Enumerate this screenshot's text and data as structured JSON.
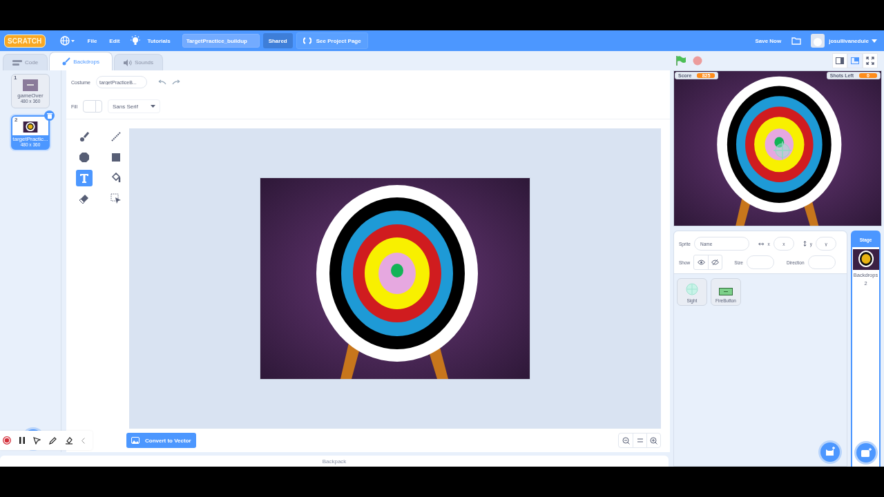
{
  "menu_bar": {
    "logo": "SCRATCH",
    "items": [
      {
        "kind": "globe"
      },
      {
        "kind": "text",
        "label": "File"
      },
      {
        "kind": "text",
        "label": "Edit"
      },
      {
        "kind": "tutorials",
        "label": "Tutorials"
      }
    ],
    "project_title": "TargetPractice_buildup",
    "shared": "Shared",
    "see_project": "See Project Page",
    "save_now": "Save Now",
    "user": "josullivaneduie"
  },
  "tabs": [
    {
      "kind": "code",
      "label": "Code",
      "selected": false
    },
    {
      "kind": "backdrops",
      "label": "Backdrops",
      "selected": true
    },
    {
      "kind": "sounds",
      "label": "Sounds",
      "selected": false
    }
  ],
  "backdrops": [
    {
      "number": "1",
      "name": "gameOver",
      "size": "480 x 360",
      "kind": "blank",
      "selected": false
    },
    {
      "number": "2",
      "name": "targetPractic...",
      "size": "480 x 360",
      "kind": "target",
      "selected": true
    }
  ],
  "paint_editor": {
    "costume_label": "Costume",
    "costume_name": "targetPracticeB...",
    "fill_label": "Fill",
    "font": "Sans Serif",
    "tools": [
      {
        "kind": "brush",
        "selected": false
      },
      {
        "kind": "line",
        "selected": false
      },
      {
        "kind": "circle",
        "selected": false
      },
      {
        "kind": "rectangle",
        "selected": false
      },
      {
        "kind": "text",
        "selected": true
      },
      {
        "kind": "fill",
        "selected": false
      },
      {
        "kind": "eraser",
        "selected": false
      },
      {
        "kind": "select",
        "selected": false
      }
    ],
    "convert_button": "Convert to Vector"
  },
  "stage": {
    "monitors": [
      {
        "label": "Score",
        "value": "825"
      },
      {
        "label": "Shots Left",
        "value": "0"
      }
    ]
  },
  "sprite_info": {
    "sprite_label": "Sprite",
    "name_placeholder": "Name",
    "x_label": "x",
    "x_placeholder": "x",
    "y_label": "y",
    "y_placeholder": "y",
    "show_label": "Show",
    "size_label": "Size",
    "direction_label": "Direction"
  },
  "sprites": [
    {
      "kind": "sight",
      "name": "Sight"
    },
    {
      "kind": "button",
      "name": "FireButton"
    }
  ],
  "stage_panel": {
    "title": "Stage",
    "backdrops_label": "Backdrops",
    "backdrops_count": "2"
  },
  "backpack": "Backpack"
}
